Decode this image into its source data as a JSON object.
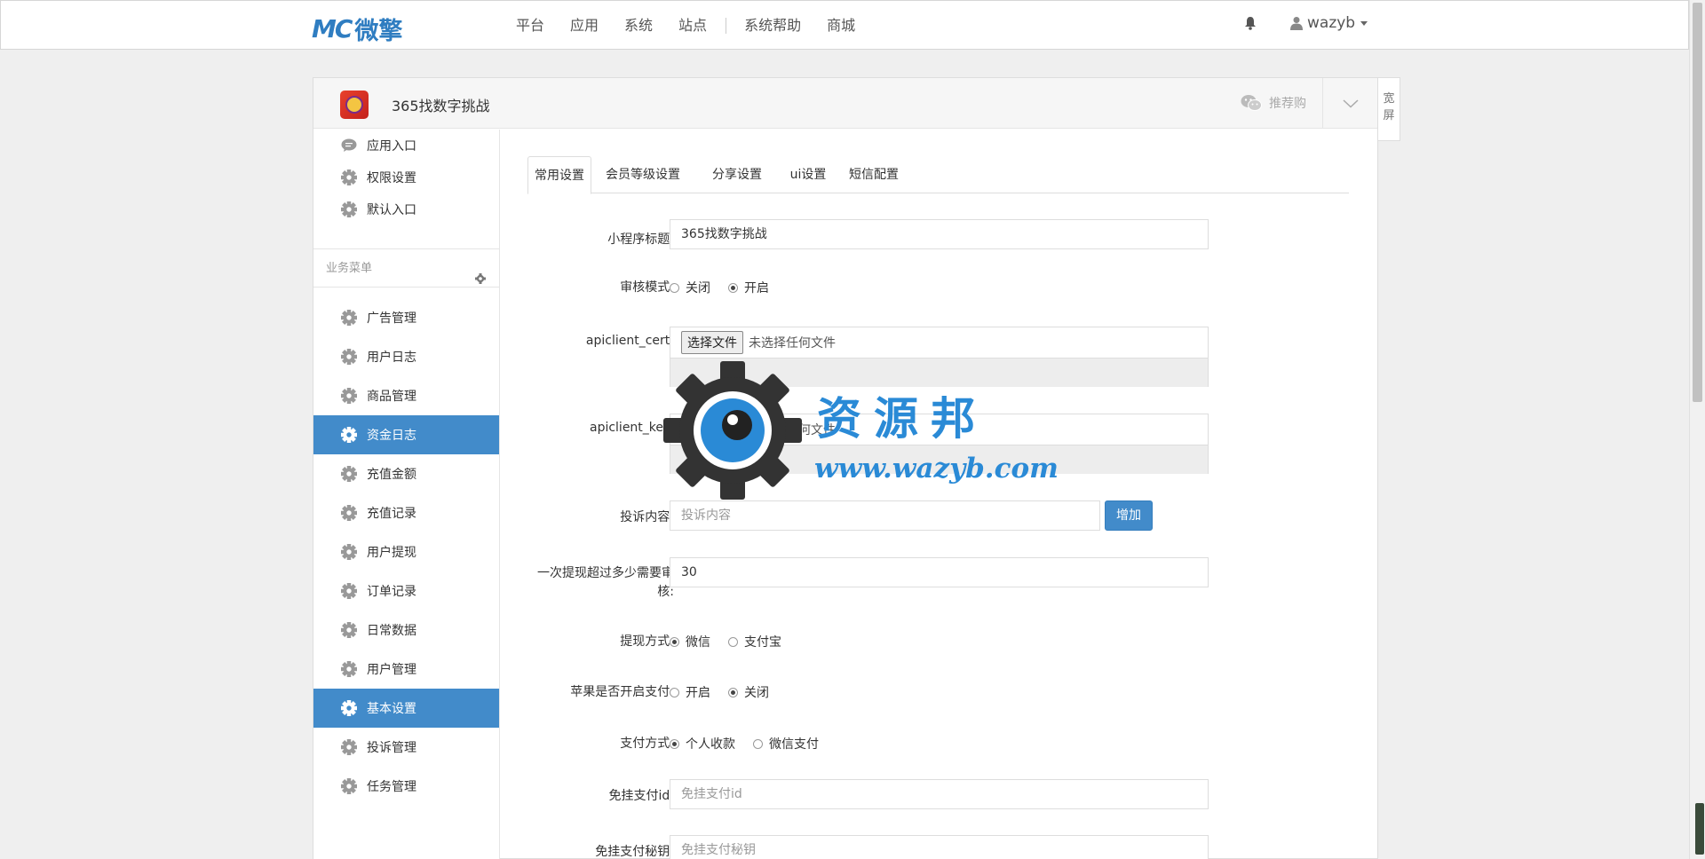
{
  "brand": {
    "mark": "MC",
    "name": "微擎"
  },
  "topnav": [
    "平台",
    "应用",
    "系统",
    "站点",
    "系统帮助",
    "商城"
  ],
  "user": {
    "name": "wazyb"
  },
  "app": {
    "title": "365找数字挑战",
    "share": "推荐购"
  },
  "wide_label_1": "宽",
  "wide_label_2": "屏",
  "sidebar": {
    "top_items": [
      "应用入口",
      "权限设置",
      "默认入口"
    ],
    "group_title": "业务菜单",
    "items": [
      "广告管理",
      "用户日志",
      "商品管理",
      "资金日志",
      "充值金额",
      "充值记录",
      "用户提现",
      "订单记录",
      "日常数据",
      "用户管理",
      "基本设置",
      "投诉管理",
      "任务管理"
    ],
    "active": [
      "资金日志",
      "基本设置"
    ]
  },
  "tabs": [
    "常用设置",
    "会员等级设置",
    "分享设置",
    "ui设置",
    "短信配置"
  ],
  "form": {
    "title_label": "小程序标题:",
    "title_value": "365找数字挑战",
    "audit_label": "审核模式:",
    "audit_opts": [
      "关闭",
      "开启"
    ],
    "cert_label": "apiclient_cert:",
    "key_label": "apiclient_key:",
    "file_btn": "选择文件",
    "file_none": "未选择任何文件",
    "complaint_label": "投诉内容:",
    "complaint_ph": "投诉内容",
    "add_btn": "增加",
    "withdraw_audit_label_1": "一次提现超过多少需要审",
    "withdraw_audit_label_2": "核:",
    "withdraw_audit_value": "30",
    "withdraw_way_label": "提现方式:",
    "withdraw_way_opts": [
      "微信",
      "支付宝"
    ],
    "apple_label": "苹果是否开启支付:",
    "apple_opts": [
      "开启",
      "关闭"
    ],
    "pay_way_label": "支付方式:",
    "pay_way_opts": [
      "个人收款",
      "微信支付"
    ],
    "free_id_label": "免挂支付id:",
    "free_id_ph": "免挂支付id",
    "free_secret_label": "免挂支付秘钥:",
    "free_secret_ph": "免挂支付秘钥"
  },
  "watermark": {
    "text": "资源邦",
    "url": "www.wazyb.com"
  }
}
